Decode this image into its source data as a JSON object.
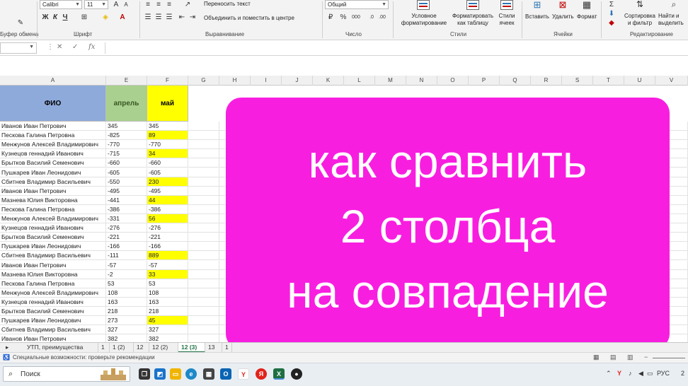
{
  "ribbon": {
    "clipboard_label": "Буфер обмена",
    "font_group_label": "Шрифт",
    "font_name": "Calibri",
    "font_size": "11",
    "bold": "Ж",
    "italic": "К",
    "underline": "Ч",
    "align_group_label": "Выравнивание",
    "wrap_text": "Переносить текст",
    "merge_center": "Объединить и поместить в центре",
    "number_group_label": "Число",
    "number_format": "Общий",
    "styles_group_label": "Стили",
    "cond_format_1": "Условное",
    "cond_format_2": "форматирование",
    "format_table_1": "Форматировать",
    "format_table_2": "как таблицу",
    "cell_styles_1": "Стили",
    "cell_styles_2": "ячеек",
    "cells_group_label": "Ячейки",
    "insert": "Вставить",
    "delete": "Удалить",
    "format": "Формат",
    "editing_group_label": "Редактирование",
    "sort_1": "Сортировка",
    "sort_2": "и фильтр",
    "find_1": "Найти и",
    "find_2": "выделить"
  },
  "formula_bar": {
    "cancel": "✕",
    "enter": "✓",
    "fx": "fx",
    "value": ""
  },
  "columns": [
    "A",
    "E",
    "F",
    "G",
    "H",
    "I",
    "J",
    "K",
    "L",
    "M",
    "N",
    "O",
    "P",
    "Q",
    "R",
    "S",
    "T",
    "U",
    "V"
  ],
  "table": {
    "headers": [
      "ФИО",
      "апрель",
      "май"
    ],
    "rows": [
      [
        "Иванов Иван Петрович",
        "345",
        "345"
      ],
      [
        "Пескова Галина Петровна",
        "-825",
        "89"
      ],
      [
        "Менжунов Алексей Владимирович",
        "-770",
        "-770"
      ],
      [
        "Кузнецов геннадий Иванович",
        "-715",
        "34"
      ],
      [
        "Брытков Василий Семенович",
        "-660",
        "-660"
      ],
      [
        "Пушкарев Иван Леонидович",
        "-605",
        "-605"
      ],
      [
        "Сбитнев Владимир Васильевич",
        "-550",
        "230"
      ],
      [
        "Иванов Иван Петрович",
        "-495",
        "-495"
      ],
      [
        "Мазнева Юлия Викторовна",
        "-441",
        "44"
      ],
      [
        "Пескова Галина Петровна",
        "-386",
        "-386"
      ],
      [
        "Менжунов Алексей Владимирович",
        "-331",
        "56"
      ],
      [
        "Кузнецов геннадий Иванович",
        "-276",
        "-276"
      ],
      [
        "Брытков Василий Семенович",
        "-221",
        "-221"
      ],
      [
        "Пушкарев Иван Леонидович",
        "-166",
        "-166"
      ],
      [
        "Сбитнев Владимир Васильевич",
        "-111",
        "889"
      ],
      [
        "Иванов Иван Петрович",
        "-57",
        "-57"
      ],
      [
        "Мазнева Юлия Викторовна",
        "-2",
        "33"
      ],
      [
        "Пескова Галина Петровна",
        "53",
        "53"
      ],
      [
        "Менжунов Алексей Владимирович",
        "108",
        "108"
      ],
      [
        "Кузнецов геннадий Иванович",
        "163",
        "163"
      ],
      [
        "Брытков Василий Семенович",
        "218",
        "218"
      ],
      [
        "Пушкарев Иван Леонидович",
        "273",
        "45"
      ],
      [
        "Сбитнев Владимир Васильевич",
        "327",
        "327"
      ],
      [
        "Иванов Иван Петрович",
        "382",
        "382"
      ]
    ],
    "highlighted_rows": [
      1,
      3,
      6,
      8,
      10,
      14,
      16,
      21
    ]
  },
  "overlay": {
    "line1": "как сравнить",
    "line2": "2 столбца",
    "line3": "на совпадение",
    "color": "#f81ee0"
  },
  "sheet_tabs": [
    "УТП, преимущества",
    "1",
    "1 (2)",
    "12",
    "12 (2)",
    "12 (3)",
    "13",
    "1"
  ],
  "active_tab": "12 (3)",
  "status": {
    "accessibility": "Специальные возможности: проверьте рекомендации"
  },
  "taskbar": {
    "search_placeholder": "Поиск",
    "lang": "РУС",
    "time": "2"
  }
}
